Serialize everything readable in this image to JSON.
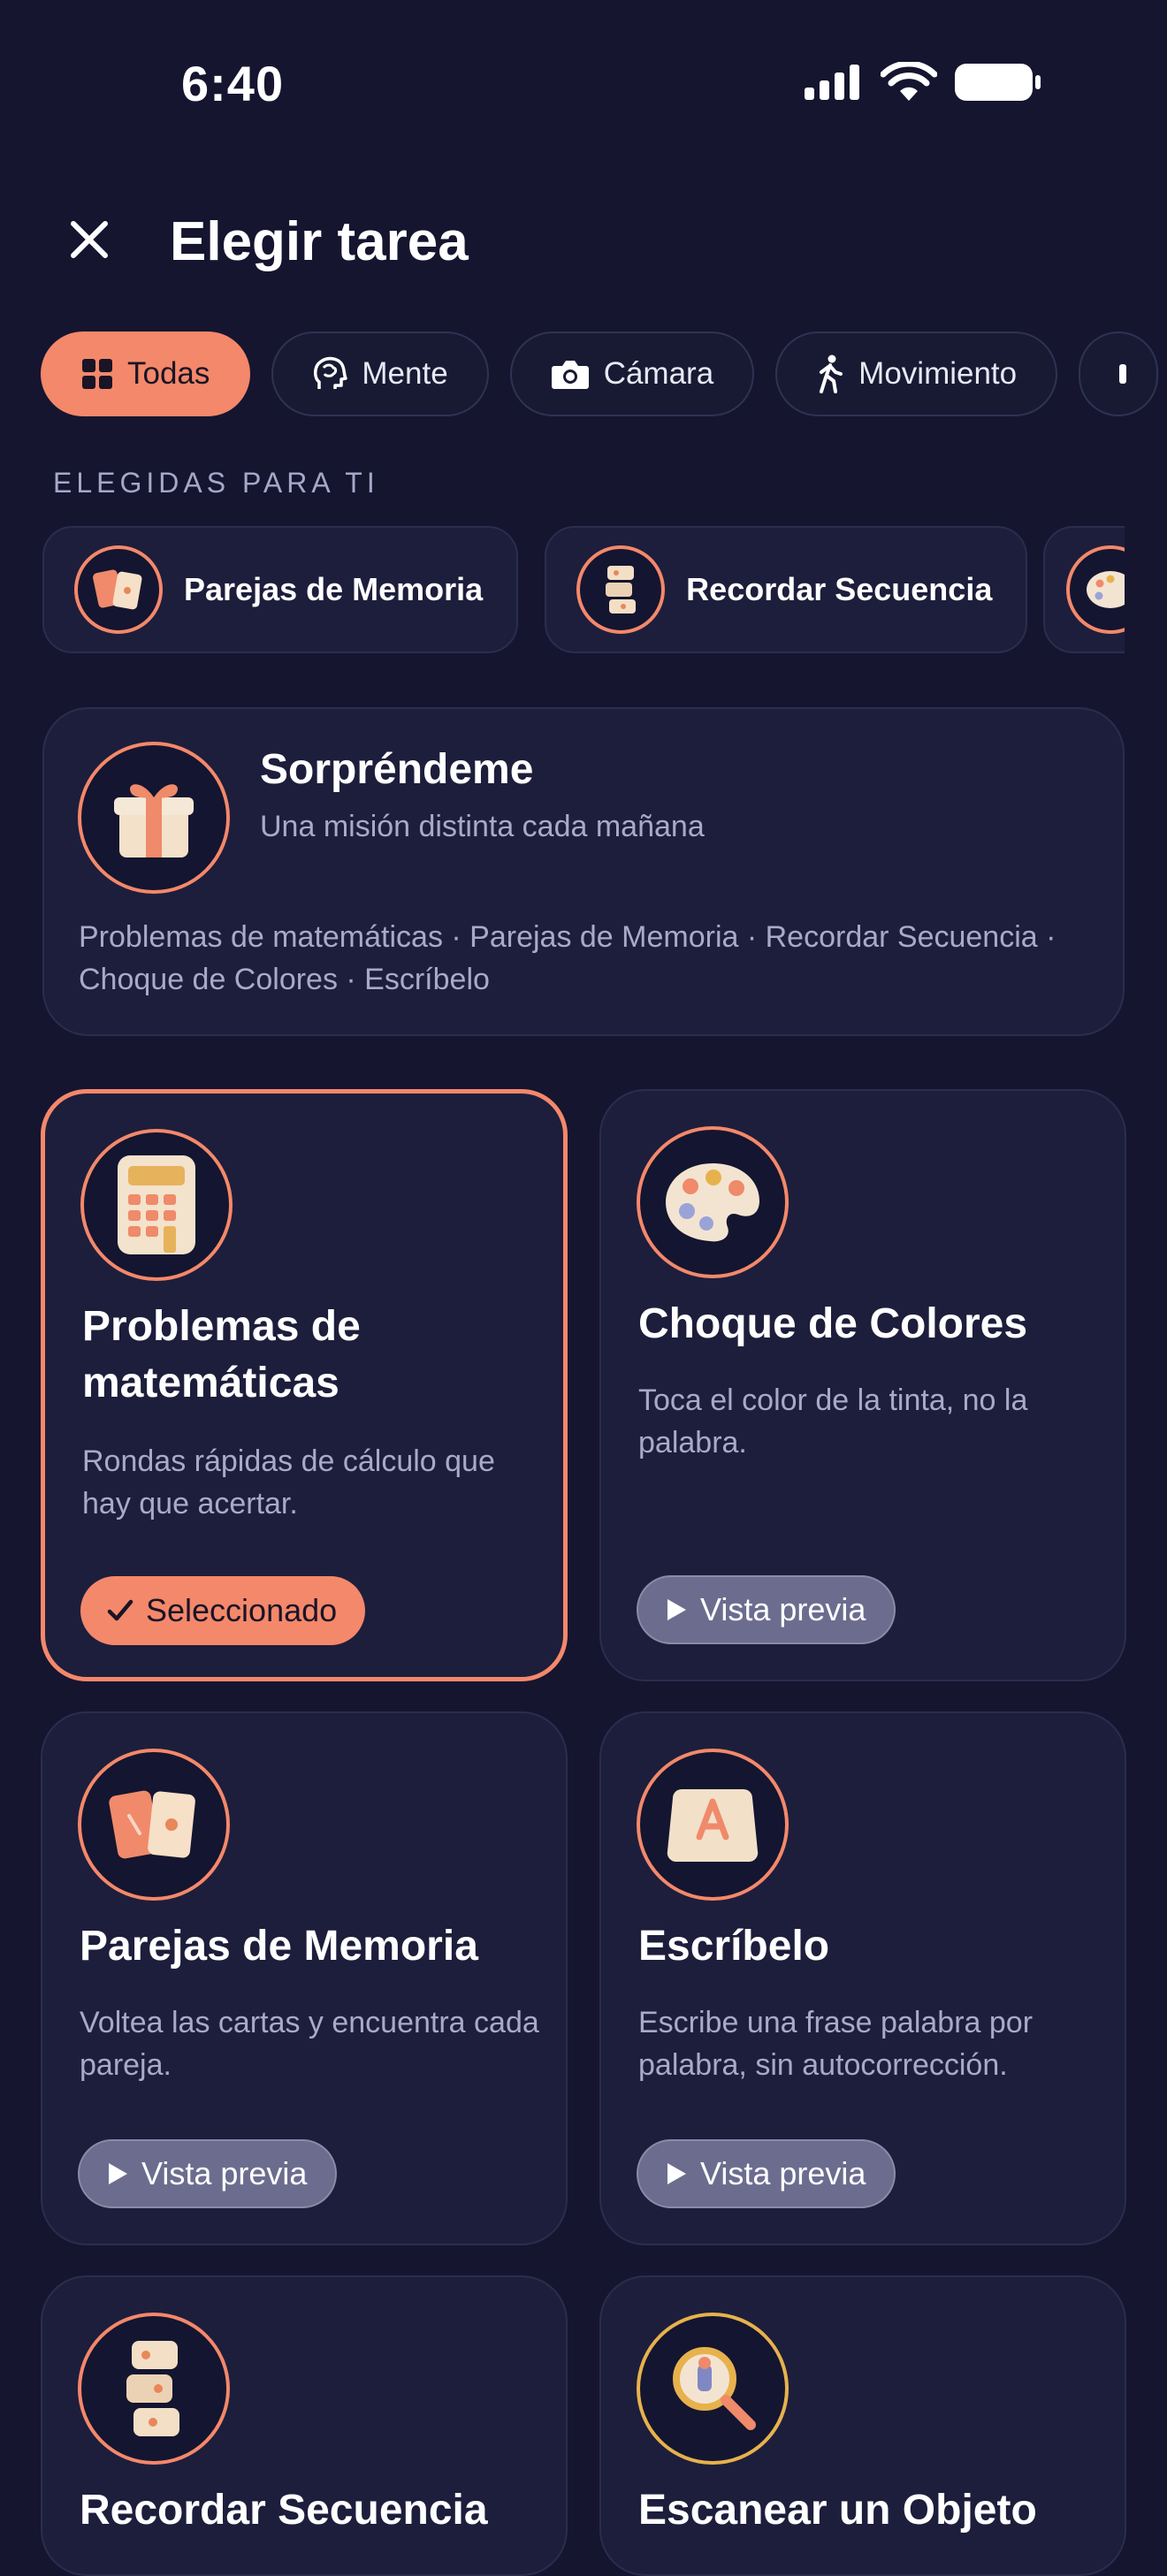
{
  "status": {
    "time": "6:40"
  },
  "header": {
    "title": "Elegir tarea"
  },
  "filters": [
    {
      "label": "Todas",
      "icon": "grid-icon",
      "active": true
    },
    {
      "label": "Mente",
      "icon": "brain-icon",
      "active": false
    },
    {
      "label": "Cámara",
      "icon": "camera-icon",
      "active": false
    },
    {
      "label": "Movimiento",
      "icon": "walking-icon",
      "active": false
    }
  ],
  "recommended": {
    "label": "ELEGIDAS PARA TI",
    "items": [
      {
        "label": "Parejas de Memoria",
        "icon": "memory-cards-icon"
      },
      {
        "label": "Recordar Secuencia",
        "icon": "sequence-blocks-icon"
      }
    ]
  },
  "surprise": {
    "title": "Sorpréndeme",
    "subtitle": "Una misión distinta cada mañana",
    "tasks_list": "Problemas de matemáticas · Parejas de Memoria · Recordar Secuencia · Choque de Colores · Escríbelo",
    "icon": "gift-icon"
  },
  "tasks": [
    {
      "title": "Problemas de matemáticas",
      "description": "Rondas rápidas de cálculo que hay que acertar.",
      "button": "Seleccionado",
      "selected": true,
      "icon": "calculator-icon"
    },
    {
      "title": "Choque de Colores",
      "description": "Toca el color de la tinta, no la palabra.",
      "button": "Vista previa",
      "selected": false,
      "icon": "palette-icon"
    },
    {
      "title": "Parejas de Memoria",
      "description": "Voltea las cartas y encuentra cada pareja.",
      "button": "Vista previa",
      "selected": false,
      "icon": "memory-cards-icon"
    },
    {
      "title": "Escríbelo",
      "description": "Escribe una frase palabra por palabra, sin autocorrección.",
      "button": "Vista previa",
      "selected": false,
      "icon": "keyboard-key-icon"
    },
    {
      "title": "Recordar Secuencia",
      "icon": "sequence-blocks-icon"
    },
    {
      "title": "Escanear un Objeto",
      "icon": "magnifier-icon"
    }
  ],
  "colors": {
    "background": "#151530",
    "card": "#1d1e3c",
    "accent": "#f4886a",
    "muted_text": "#a8aac8"
  }
}
